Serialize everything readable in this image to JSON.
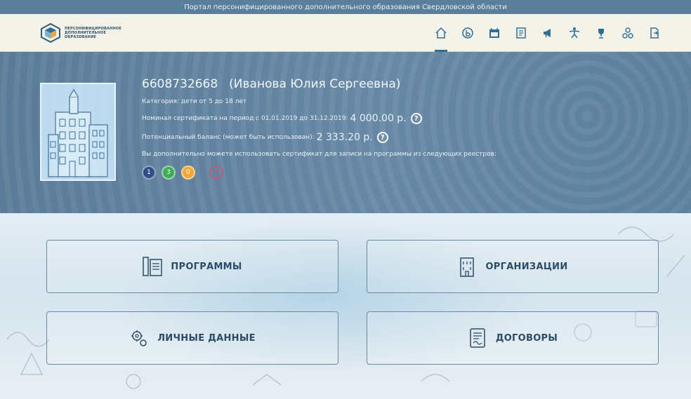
{
  "portal_title": "Портал персонифицированного дополнительного образования Свердловской области",
  "logo": {
    "lines": [
      "ПЕРСОНИФИЦИРОВАННОЕ",
      "ДОПОЛНИТЕЛЬНОЕ",
      "ОБРАЗОВАНИЕ"
    ]
  },
  "nav": [
    {
      "name": "home-icon"
    },
    {
      "name": "balance-icon"
    },
    {
      "name": "calendar-icon"
    },
    {
      "name": "document-icon"
    },
    {
      "name": "megaphone-icon"
    },
    {
      "name": "sport-icon"
    },
    {
      "name": "trophy-icon"
    },
    {
      "name": "people-icon"
    },
    {
      "name": "logout-icon"
    }
  ],
  "profile": {
    "certificate_number": "6608732668",
    "full_name": "(Иванова Юлия Сергеевна)",
    "category": "Категория: дети от 5 до 18 лет",
    "nominal_label": "Номинал сертификата на период с 01.01.2019 до 31.12.2019:",
    "nominal_value": "4 000.00 р.",
    "balance_label": "Потенциальный баланс (может быть использован):",
    "balance_value": "2 333.20 р.",
    "registries_label": "Вы дополнительно можете использовать сертификат для записи на программы из следующих реестров:",
    "help_mark": "?",
    "registries": [
      {
        "label": "1",
        "color": "#2f4f86"
      },
      {
        "label": "3",
        "color": "#3fae57"
      },
      {
        "label": "0",
        "color": "#f2a73b"
      }
    ]
  },
  "tiles": {
    "programs": "ПРОГРАММЫ",
    "organizations": "ОРГАНИЗАЦИИ",
    "personal_data": "ЛИЧНЫЕ ДАННЫЕ",
    "contracts": "ДОГОВОРЫ"
  }
}
